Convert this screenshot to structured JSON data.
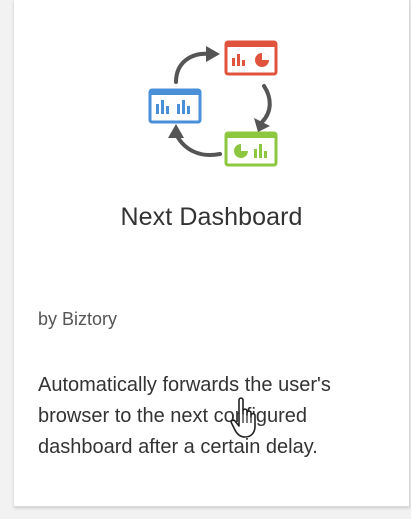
{
  "extension": {
    "logo_icon": "cycle-dashboards-icon",
    "title": "Next Dashboard",
    "author": "by Biztory",
    "description": "Automatically forwards the user's browser to the next configured dashboard after a certain delay."
  },
  "colors": {
    "red_panel": "#e0533d",
    "green_panel": "#8dc63f",
    "blue_panel": "#4a90d9",
    "arrow": "#555555"
  },
  "cursor": {
    "icon": "hand-pointer-icon"
  }
}
